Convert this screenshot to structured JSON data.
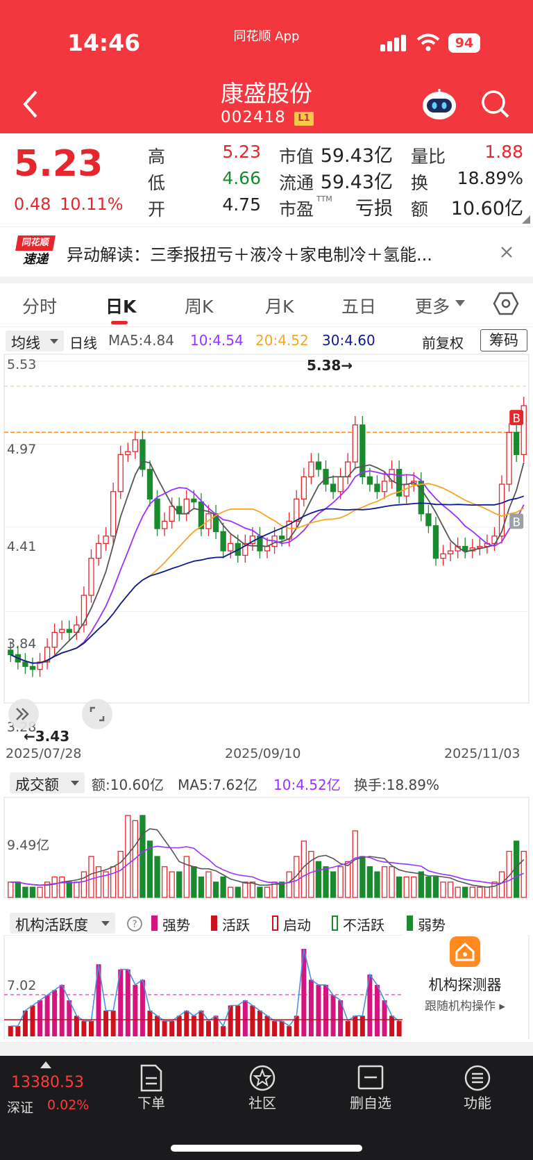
{
  "status": {
    "time": "14:46",
    "app": "同花顺 App",
    "battery": "94"
  },
  "header": {
    "title": "康盛股份",
    "code": "002418",
    "level": "L1"
  },
  "quote": {
    "price": "5.23",
    "change": "0.48",
    "change_pct": "10.11%",
    "high_label": "高",
    "high": "5.23",
    "low_label": "低",
    "low": "4.66",
    "open_label": "开",
    "open": "4.75",
    "mcap_label": "市值",
    "mcap": "59.43亿",
    "float_label": "流通",
    "float": "59.43亿",
    "pe_label": "市盈",
    "pe_sup": "TTM",
    "pe": "亏损",
    "vr_label": "量比",
    "vr": "1.88",
    "turn_label": "换",
    "turn": "18.89%",
    "amt_label": "额",
    "amt": "10.60亿"
  },
  "news": {
    "badge_top": "同花顺",
    "badge_bottom": "速递",
    "text": "异动解读：三季报扭亏＋液冷＋家电制冷＋氢能..."
  },
  "tabs": [
    {
      "label": "分时"
    },
    {
      "label": "日K"
    },
    {
      "label": "周K"
    },
    {
      "label": "月K"
    },
    {
      "label": "五日"
    },
    {
      "label": "更多"
    }
  ],
  "kline": {
    "selector": "均线",
    "period": "日线",
    "ma5": "MA5:4.84",
    "ma10": "10:4.54",
    "ma20": "20:4.52",
    "ma30": "30:4.60",
    "adjust": "前复权",
    "chips": "筹码",
    "y_labels": [
      "5.53",
      "4.97",
      "4.41",
      "3.84",
      "3.28"
    ],
    "max_label": "5.38→",
    "min_label": "←3.43",
    "dates": [
      "2025/07/28",
      "2025/09/10",
      "2025/11/03"
    ],
    "b_label": "B",
    "colors": {
      "ma5": "#555555",
      "ma10": "#9b30ff",
      "ma20": "#f5a623",
      "ma30": "#0b1a8c",
      "up": "#e6262d",
      "down": "#1a8a2e"
    }
  },
  "volume": {
    "selector": "成交额",
    "amt": "额:10.60亿",
    "ma5": "MA5:7.62亿",
    "ma10": "10:4.52亿",
    "turnover": "换手:18.89%",
    "y_label": "9.49亿"
  },
  "activity": {
    "selector": "机构活跃度",
    "legend": [
      "强势",
      "活跃",
      "启动",
      "不活跃",
      "弱势"
    ],
    "y_label": "7.02",
    "detector_title": "机构探测器",
    "detector_sub": "跟随机构操作 ▸"
  },
  "bottom": {
    "index_value": "13380.53",
    "index_name": "深证",
    "index_pct": "0.02%",
    "items": [
      {
        "label": "下单"
      },
      {
        "label": "社区"
      },
      {
        "label": "删自选"
      },
      {
        "label": "功能"
      }
    ]
  }
}
